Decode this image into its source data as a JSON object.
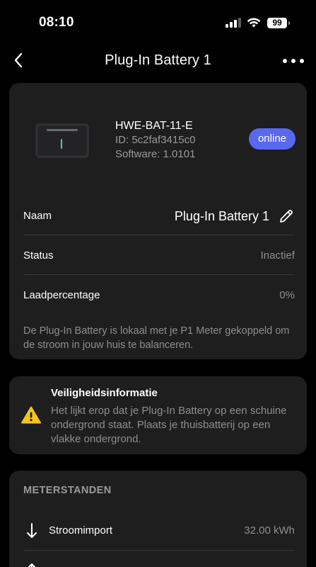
{
  "status_bar": {
    "time": "08:10",
    "battery_level": "99",
    "signal_icon": "cellular-signal-icon",
    "wifi_icon": "wifi-icon"
  },
  "nav": {
    "title": "Plug-In Battery 1",
    "back_icon": "chevron-left-icon",
    "more_icon": "more-horizontal-icon"
  },
  "device": {
    "model": "HWE-BAT-11-E",
    "id": "ID: 5c2faf3415c0",
    "software": "Software: 1.0101",
    "status_badge": "online",
    "badge_color": "#5a68f0",
    "rows": {
      "name": {
        "label": "Naam",
        "value": "Plug-In Battery 1"
      },
      "status": {
        "label": "Status",
        "value": "Inactief"
      },
      "charge": {
        "label": "Laadpercentage",
        "value": "0%"
      }
    },
    "description": "De Plug-In Battery is lokaal met je P1 Meter gekoppeld om de stroom in jouw huis te balanceren."
  },
  "safety": {
    "title": "Veiligheidsinformatie",
    "text": "Het lijkt erop dat je Plug-In Battery op een schuine ondergrond staat. Plaats je thuisbatterij op een vlakke ondergrond.",
    "icon": "warning-icon",
    "icon_color": "#f5c518"
  },
  "meter": {
    "heading": "METERSTANDEN",
    "import": {
      "label": "Stroomimport",
      "value": "32.00 kWh",
      "icon": "arrow-down-icon"
    }
  }
}
